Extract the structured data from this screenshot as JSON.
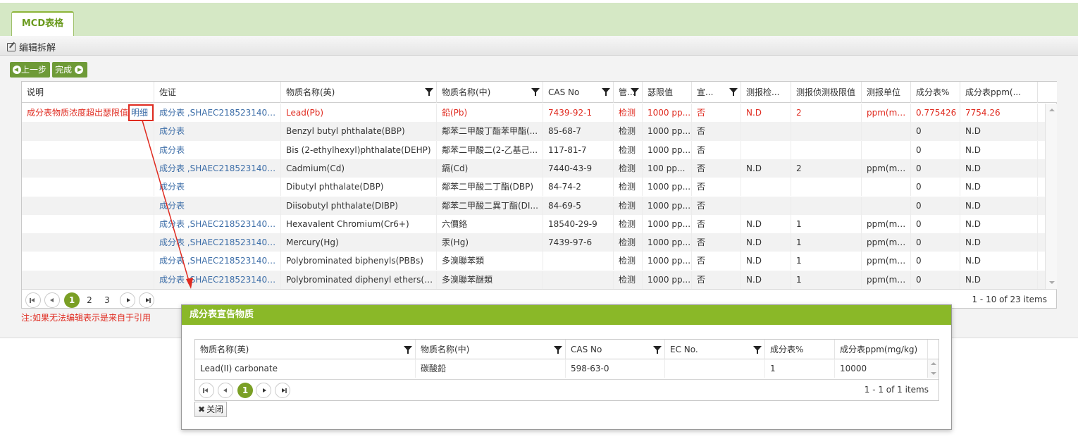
{
  "tab": {
    "label": "MCD表格"
  },
  "toolbar": {
    "title": "编辑拆解"
  },
  "buttons": {
    "prev": "上一步",
    "finish": "完成"
  },
  "grid": {
    "headers": [
      "说明",
      "佐证",
      "物质名称(英)",
      "物质名称(中)",
      "CAS No",
      "管...",
      "瑟限值",
      "宣...",
      "测报检...",
      "测报侦测极限值",
      "测报单位",
      "成分表%",
      "成分表ppm(..."
    ],
    "rows": [
      [
        "成分表物质浓度超出瑟限值",
        "成分表 ,SHAEC2185231401/...",
        "Lead(Pb)",
        "鉛(Pb)",
        "7439-92-1",
        "检测",
        "1000 pp...",
        "否",
        "N.D",
        "2",
        "ppm(mg...",
        "0.775426",
        "7754.26"
      ],
      [
        "",
        "成分表",
        "Benzyl butyl phthalate(BBP)",
        "鄰苯二甲酸丁酯苯甲酯(...",
        "85-68-7",
        "检测",
        "1000 pp...",
        "否",
        "",
        "",
        "",
        "0",
        "N.D"
      ],
      [
        "",
        "成分表",
        "Bis (2-ethylhexyl)phthalate(DEHP)",
        "鄰苯二甲酸二(2-乙基己...",
        "117-81-7",
        "检测",
        "1000 pp...",
        "否",
        "",
        "",
        "",
        "0",
        "N.D"
      ],
      [
        "",
        "成分表 ,SHAEC2185231401/...",
        "Cadmium(Cd)",
        "鎘(Cd)",
        "7440-43-9",
        "检测",
        "100 pp...",
        "否",
        "N.D",
        "2",
        "ppm(mg...",
        "0",
        "N.D"
      ],
      [
        "",
        "成分表",
        "Dibutyl phthalate(DBP)",
        "鄰苯二甲酸二丁酯(DBP)",
        "84-74-2",
        "检测",
        "1000 pp...",
        "否",
        "",
        "",
        "",
        "0",
        "N.D"
      ],
      [
        "",
        "成分表",
        "Diisobutyl phthalate(DIBP)",
        "鄰苯二甲酸二異丁酯(DI...",
        "84-69-5",
        "检测",
        "1000 pp...",
        "否",
        "",
        "",
        "",
        "0",
        "N.D"
      ],
      [
        "",
        "成分表 ,SHAEC2185231401/...",
        "Hexavalent Chromium(Cr6+)",
        "六價鉻",
        "18540-29-9",
        "检测",
        "1000 pp...",
        "否",
        "N.D",
        "1",
        "ppm(mg...",
        "0",
        "N.D"
      ],
      [
        "",
        "成分表 ,SHAEC2185231401/...",
        "Mercury(Hg)",
        "汞(Hg)",
        "7439-97-6",
        "检测",
        "1000 pp...",
        "否",
        "N.D",
        "1",
        "ppm(mg...",
        "0",
        "N.D"
      ],
      [
        "",
        "成分表 ,SHAEC2185231401/...",
        "Polybrominated biphenyls(PBBs)",
        "多溴聯苯類",
        "",
        "检测",
        "1000 pp...",
        "否",
        "N.D",
        "1",
        "ppm(mg...",
        "0",
        "N.D"
      ],
      [
        "",
        "成分表 ,SHAEC2185231401/...",
        "Polybrominated diphenyl ethers(PB...",
        "多溴聯苯醚類",
        "",
        "检测",
        "1000 pp...",
        "否",
        "N.D",
        "1",
        "ppm(mg...",
        "0",
        "N.D"
      ]
    ],
    "detail_link": "明细",
    "pages": [
      "1",
      "2",
      "3"
    ],
    "page_info": "1 - 10 of 23 items"
  },
  "note": "注:如果无法编辑表示是来自于引用",
  "dialog": {
    "title": "成分表宣告物质",
    "headers": [
      "物质名称(英)",
      "物质名称(中)",
      "CAS No",
      "EC No.",
      "成分表%",
      "成分表ppm(mg/kg)"
    ],
    "rows": [
      [
        "Lead(II) carbonate",
        "碳酸鉛",
        "598-63-0",
        "",
        "1",
        "10000"
      ]
    ],
    "pages": [
      "1"
    ],
    "page_info": "1 - 1 of 1 items",
    "close_label": "关闭"
  },
  "colors": {
    "accent": "#8ab828",
    "link": "#3d6ea8",
    "alert": "#e02b20"
  }
}
